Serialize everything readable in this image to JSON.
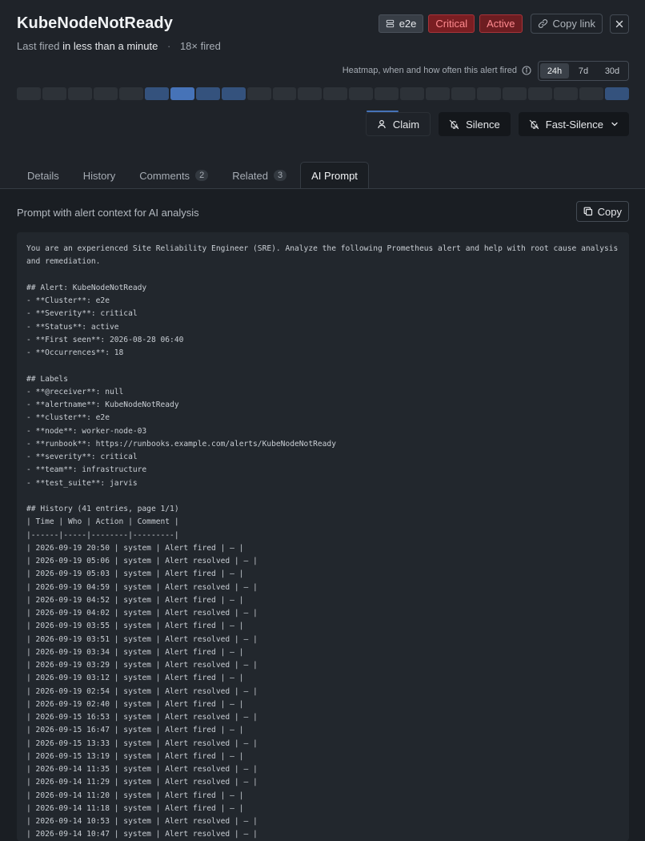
{
  "alert": {
    "title": "KubeNodeNotReady",
    "last_fired_label": "Last fired",
    "last_fired_value": "in less than a minute",
    "separator": "·",
    "fired_count": "18× fired",
    "cluster_badge": "e2e",
    "severity_badge": "Critical",
    "status_badge": "Active",
    "copy_link_label": "Copy link"
  },
  "heatmap": {
    "caption": "Heatmap, when and how often this alert fired",
    "ranges": [
      "24h",
      "7d",
      "30d"
    ],
    "selected_range": "24h",
    "levels": [
      0,
      0,
      0,
      0,
      0,
      1,
      2,
      1,
      1,
      0,
      0,
      0,
      0,
      0,
      0,
      0,
      0,
      0,
      0,
      0,
      0,
      0,
      0,
      1
    ],
    "colors": {
      "empty": "#2d3238",
      "low": "#34527d",
      "high": "#4673b8"
    }
  },
  "actions": {
    "claim": "Claim",
    "silence": "Silence",
    "fast_silence": "Fast-Silence"
  },
  "tabs": [
    {
      "label": "Details",
      "count": ""
    },
    {
      "label": "History",
      "count": ""
    },
    {
      "label": "Comments",
      "count": "2"
    },
    {
      "label": "Related",
      "count": "3"
    },
    {
      "label": "AI Prompt",
      "count": ""
    }
  ],
  "selected_tab": "AI Prompt",
  "prompt": {
    "heading": "Prompt with alert context for AI analysis",
    "copy_label": "Copy",
    "lines": [
      "You are an experienced Site Reliability Engineer (SRE). Analyze the following Prometheus alert and help with root cause analysis and remediation.",
      "",
      "## Alert: KubeNodeNotReady",
      "- **Cluster**: e2e",
      "- **Severity**: critical",
      "- **Status**: active",
      "- **First seen**: 2026-08-28 06:40",
      "- **Occurrences**: 18",
      "",
      "## Labels",
      "- **@receiver**: null",
      "- **alertname**: KubeNodeNotReady",
      "- **cluster**: e2e",
      "- **node**: worker-node-03",
      "- **runbook**: https://runbooks.example.com/alerts/KubeNodeNotReady",
      "- **severity**: critical",
      "- **team**: infrastructure",
      "- **test_suite**: jarvis",
      "",
      "## History (41 entries, page 1/1)",
      "| Time | Who | Action | Comment |",
      "|------|-----|--------|---------|",
      "| 2026-09-19 20:50 | system | Alert fired | — |",
      "| 2026-09-19 05:06 | system | Alert resolved | — |",
      "| 2026-09-19 05:03 | system | Alert fired | — |",
      "| 2026-09-19 04:59 | system | Alert resolved | — |",
      "| 2026-09-19 04:52 | system | Alert fired | — |",
      "| 2026-09-19 04:02 | system | Alert resolved | — |",
      "| 2026-09-19 03:55 | system | Alert fired | — |",
      "| 2026-09-19 03:51 | system | Alert resolved | — |",
      "| 2026-09-19 03:34 | system | Alert fired | — |",
      "| 2026-09-19 03:29 | system | Alert resolved | — |",
      "| 2026-09-19 03:12 | system | Alert fired | — |",
      "| 2026-09-19 02:54 | system | Alert resolved | — |",
      "| 2026-09-19 02:40 | system | Alert fired | — |",
      "| 2026-09-15 16:53 | system | Alert resolved | — |",
      "| 2026-09-15 16:47 | system | Alert fired | — |",
      "| 2026-09-15 13:33 | system | Alert resolved | — |",
      "| 2026-09-15 13:19 | system | Alert fired | — |",
      "| 2026-09-14 11:35 | system | Alert resolved | — |",
      "| 2026-09-14 11:29 | system | Alert resolved | — |",
      "| 2026-09-14 11:20 | system | Alert fired | — |",
      "| 2026-09-14 11:18 | system | Alert fired | — |",
      "| 2026-09-14 10:53 | system | Alert resolved | — |",
      "| 2026-09-14 10:47 | system | Alert resolved | — |"
    ]
  }
}
